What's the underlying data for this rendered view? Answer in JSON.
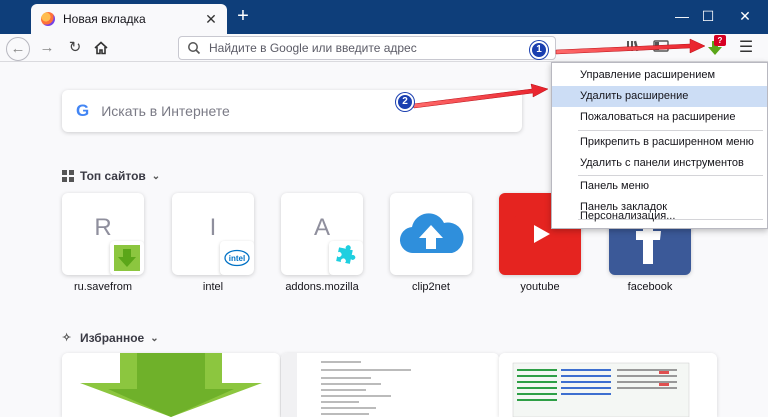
{
  "tab": {
    "title": "Новая вкладка",
    "close": "✕",
    "new_tab": "+"
  },
  "window_controls": {
    "minimize": "—",
    "maximize": "☐",
    "close": "✕"
  },
  "urlbar": {
    "placeholder": "Найдите в Google или введите адрес"
  },
  "extension": {
    "badge": "?"
  },
  "search": {
    "logo": "G",
    "placeholder": "Искать в Интернете"
  },
  "top_sites": {
    "title": "Топ сайтов",
    "tiles": [
      {
        "letter": "R",
        "label": "ru.savefrom",
        "icon": "savefrom-arrow-icon"
      },
      {
        "letter": "I",
        "label": "intel",
        "icon": "intel-logo-icon"
      },
      {
        "letter": "A",
        "label": "addons.mozilla",
        "icon": "puzzle-piece-icon"
      },
      {
        "letter": "",
        "label": "clip2net",
        "icon": "cloud-upload-icon"
      },
      {
        "letter": "",
        "label": "youtube",
        "icon": "youtube-play-icon"
      },
      {
        "letter": "",
        "label": "facebook",
        "icon": "facebook-f-icon"
      }
    ]
  },
  "highlights": {
    "title": "Избранное"
  },
  "menu": {
    "items": [
      "Управление расширением",
      "Удалить расширение",
      "Пожаловаться на расширение",
      "Прикрепить в расширенном меню",
      "Удалить с панели инструментов",
      "Панель меню",
      "Панель закладок",
      "Персонализация..."
    ]
  },
  "callouts": [
    "1",
    "2"
  ],
  "colors": {
    "titlebar": "#0e3e7a",
    "menu_highlight": "#ccddf5",
    "callout": "#1a3fb0",
    "arrow": "#e8202a"
  }
}
